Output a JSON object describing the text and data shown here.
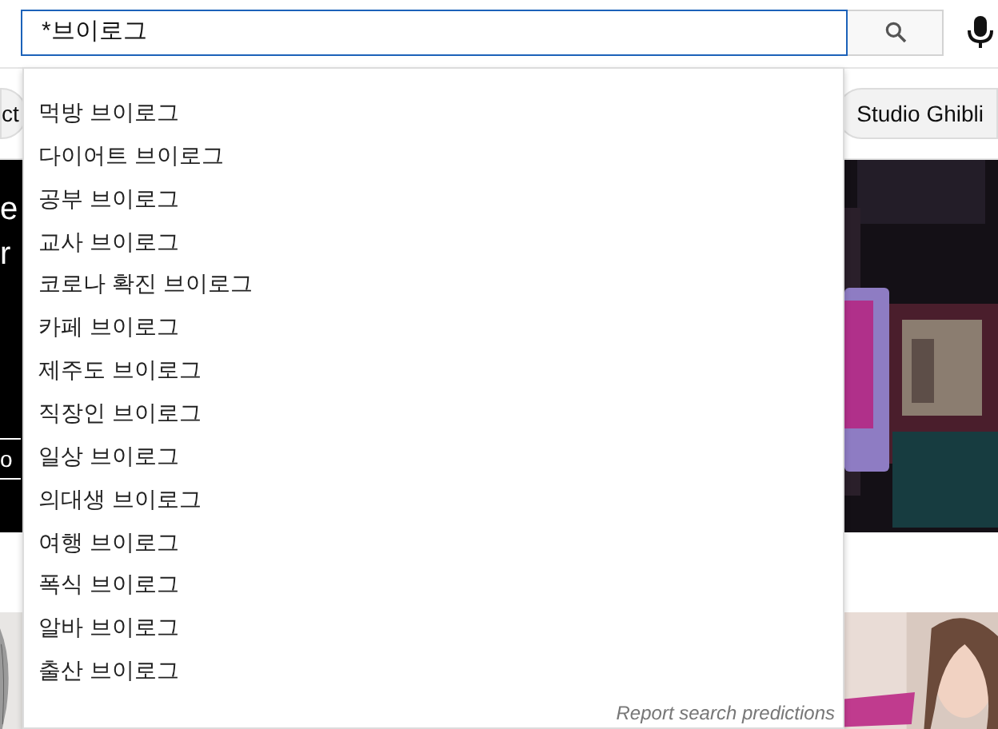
{
  "search": {
    "value": "*브이로그"
  },
  "chips": [
    {
      "label": "ct"
    },
    {
      "label": "Studio Ghibli"
    }
  ],
  "banner": {
    "texts": [
      {
        "kind": "title",
        "text": "e"
      },
      {
        "kind": "title",
        "text": "r"
      },
      {
        "kind": "button",
        "text": "o"
      }
    ]
  },
  "suggestions": [
    {
      "text": "먹방 브이로그"
    },
    {
      "text": "다이어트 브이로그"
    },
    {
      "text": "공부 브이로그"
    },
    {
      "text": "교사 브이로그"
    },
    {
      "text": "코로나 확진 브이로그"
    },
    {
      "text": "카페 브이로그"
    },
    {
      "text": "제주도 브이로그"
    },
    {
      "text": "직장인 브이로그"
    },
    {
      "text": "일상 브이로그"
    },
    {
      "text": "의대생 브이로그"
    },
    {
      "text": "여행 브이로그"
    },
    {
      "text": "폭식 브이로그"
    },
    {
      "text": "알바 브이로그"
    },
    {
      "text": "출산 브이로그"
    }
  ],
  "report_link": "Report search predictions"
}
